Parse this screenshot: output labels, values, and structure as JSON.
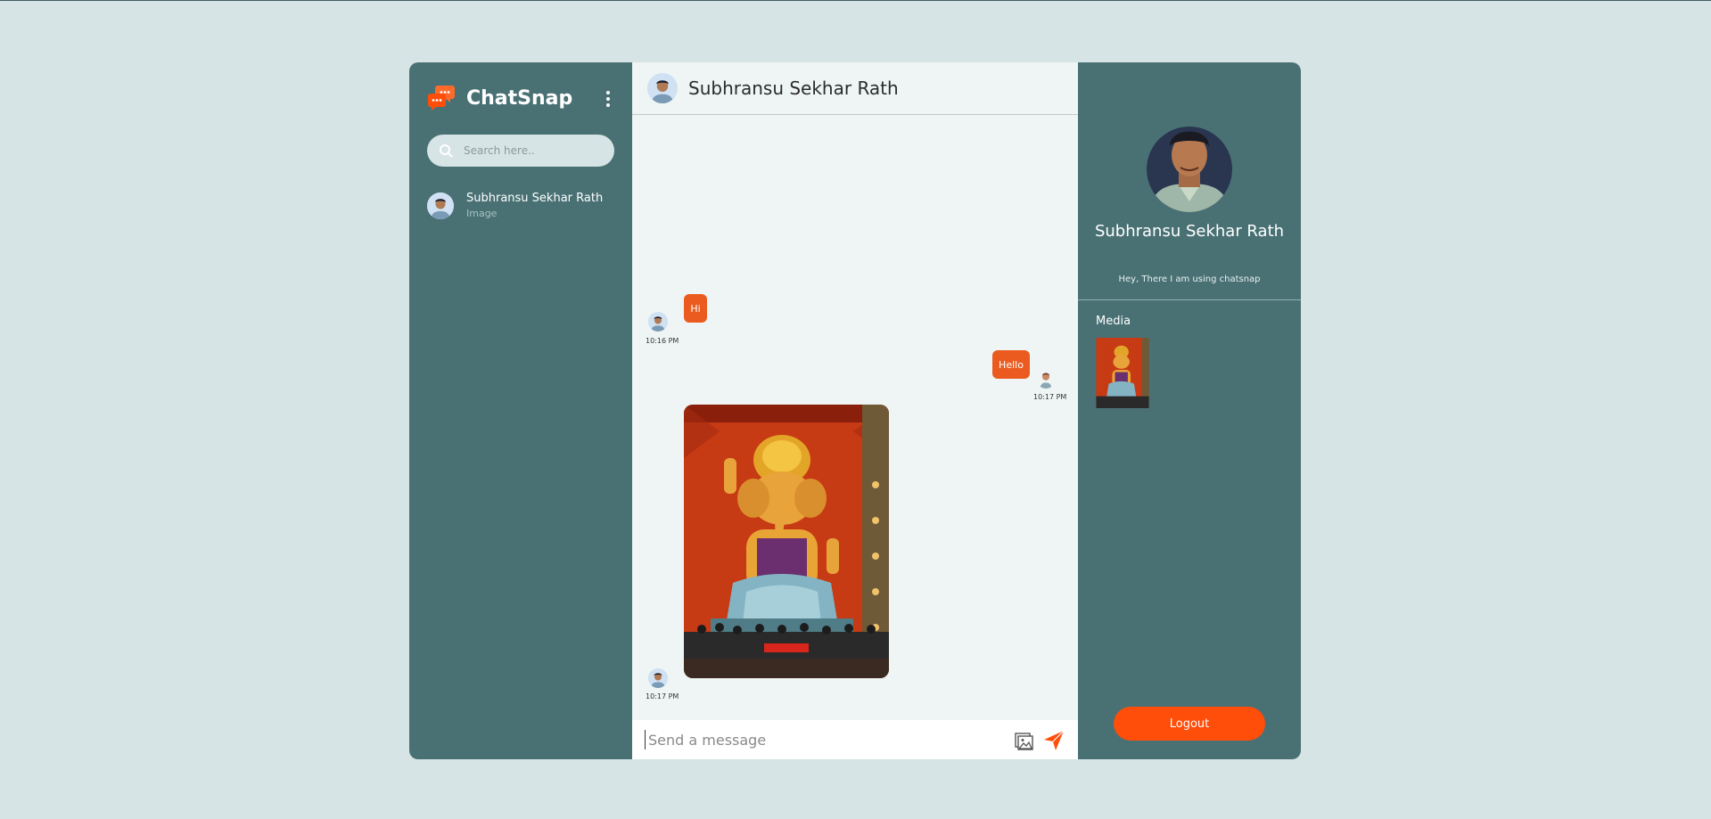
{
  "app": {
    "name": "ChatSnap"
  },
  "sidebar": {
    "search_placeholder": "Search here..",
    "contacts": [
      {
        "name": "Subhransu Sekhar Rath",
        "subtitle": "Image"
      }
    ]
  },
  "chat": {
    "title": "Subhransu Sekhar Rath",
    "messages": [
      {
        "text": "Hi",
        "time": "10:16 PM",
        "direction": "incoming"
      },
      {
        "text": "Hello",
        "time": "10:17 PM",
        "direction": "outgoing"
      },
      {
        "type": "image",
        "time": "10:17 PM",
        "direction": "incoming"
      }
    ],
    "composer_placeholder": "Send a message"
  },
  "profile": {
    "name": "Subhransu Sekhar Rath",
    "status": "Hey, There I am using chatsnap",
    "media_label": "Media",
    "logout_label": "Logout"
  },
  "colors": {
    "page_bg": "#d6e4e5",
    "panel": "#497174",
    "chat_bg": "#eff5f5",
    "accent": "#eb5b1f",
    "logout": "#ff4d0a"
  }
}
